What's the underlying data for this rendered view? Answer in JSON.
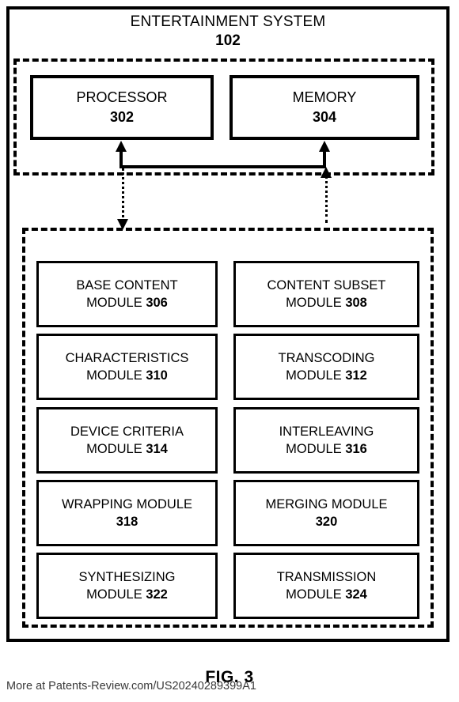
{
  "figure": {
    "title": "ENTERTAINMENT SYSTEM",
    "title_ref": "102",
    "caption": "FIG. 3"
  },
  "hardware": {
    "boxes": [
      {
        "label": "PROCESSOR",
        "ref": "302",
        "name": "processor"
      },
      {
        "label": "MEMORY",
        "ref": "304",
        "name": "memory"
      }
    ]
  },
  "modules": {
    "rows": [
      [
        {
          "line1": "BASE CONTENT",
          "line2": "MODULE ",
          "ref": "306"
        },
        {
          "line1": "CONTENT SUBSET",
          "line2": "MODULE ",
          "ref": "308"
        }
      ],
      [
        {
          "line1": "CHARACTERISTICS",
          "line2": "MODULE ",
          "ref": "310"
        },
        {
          "line1": "TRANSCODING",
          "line2": "MODULE ",
          "ref": "312"
        }
      ],
      [
        {
          "line1": "DEVICE CRITERIA",
          "line2": "MODULE ",
          "ref": "314"
        },
        {
          "line1": "INTERLEAVING",
          "line2": "MODULE ",
          "ref": "316"
        }
      ],
      [
        {
          "line1": "WRAPPING MODULE",
          "line2": "",
          "ref": "318"
        },
        {
          "line1": "MERGING MODULE",
          "line2": "",
          "ref": "320"
        }
      ],
      [
        {
          "line1": "SYNTHESIZING",
          "line2": "MODULE ",
          "ref": "322"
        },
        {
          "line1": "TRANSMISSION",
          "line2": "MODULE ",
          "ref": "324"
        }
      ]
    ]
  },
  "watermark": {
    "text": "More at Patents-Review.com/US20240289399A1"
  },
  "colors": {
    "ink": "#000000",
    "background": "#ffffff",
    "watermark": "#3a3a3a"
  }
}
